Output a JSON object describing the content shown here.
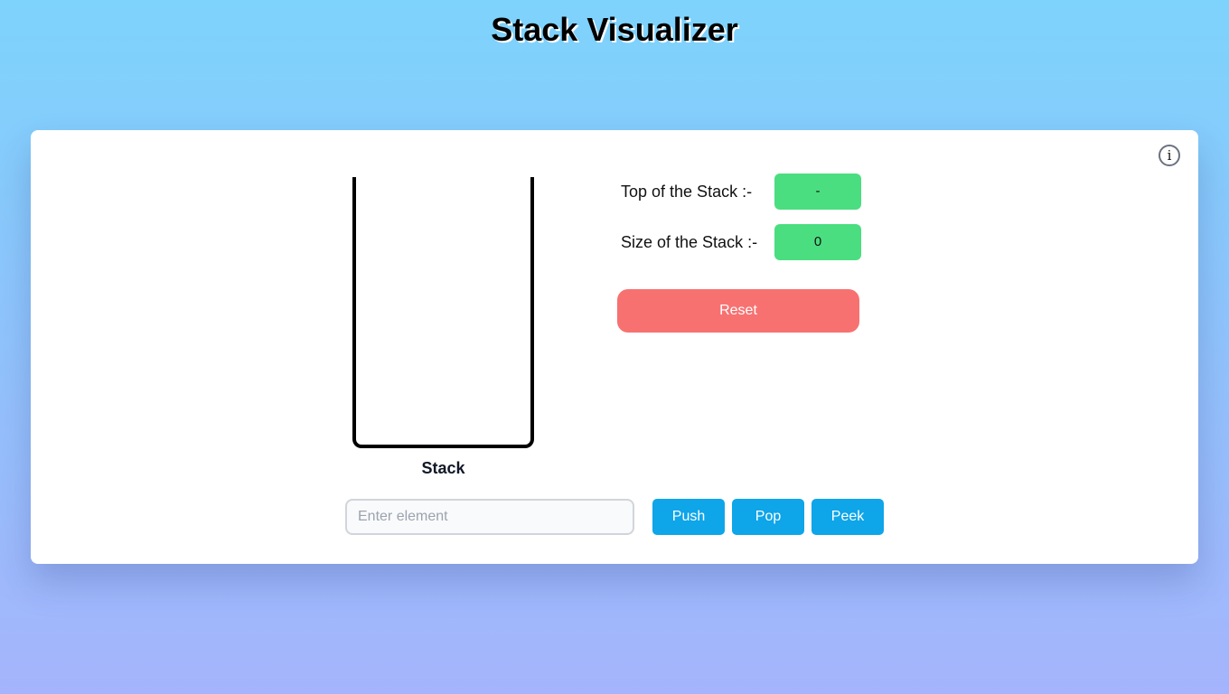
{
  "header": {
    "title": "Stack Visualizer"
  },
  "info": {
    "icon_glyph": "i",
    "icon_name": "info-icon"
  },
  "stack": {
    "label": "Stack",
    "elements": []
  },
  "stats": {
    "top_label": "Top of the Stack :-",
    "top_value": "-",
    "size_label": "Size of the Stack :-",
    "size_value": "0"
  },
  "controls": {
    "reset_label": "Reset",
    "input_placeholder": "Enter element",
    "input_value": "",
    "push_label": "Push",
    "pop_label": "Pop",
    "peek_label": "Peek"
  },
  "colors": {
    "stat_badge": "#4ade80",
    "reset": "#f87171",
    "action": "#0ea5e9"
  }
}
